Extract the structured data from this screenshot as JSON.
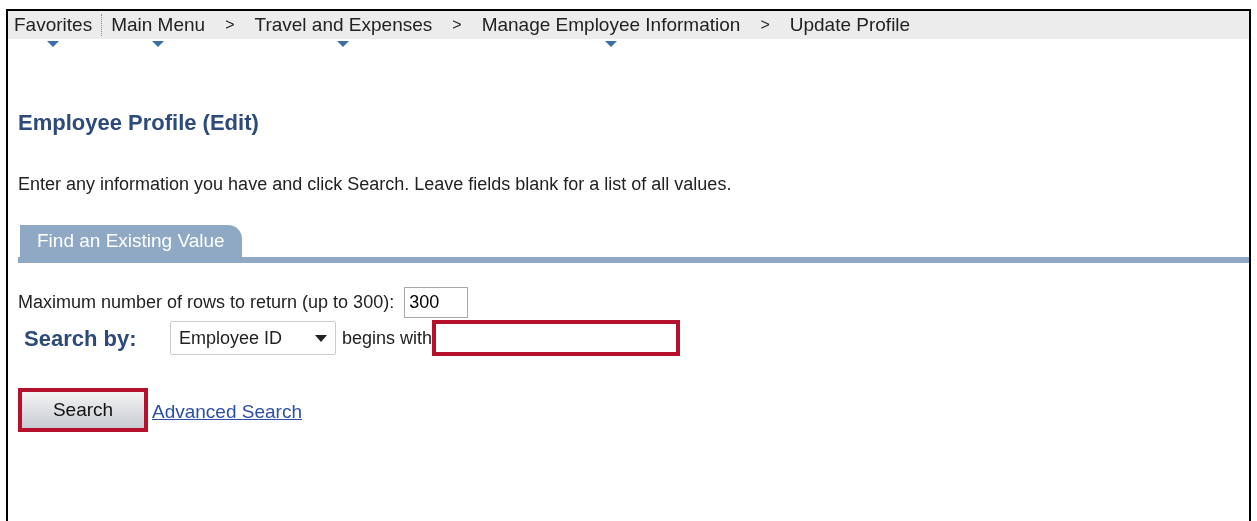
{
  "breadcrumb": [
    {
      "label": "Favorites",
      "dropdown": true
    },
    {
      "label": "Main Menu",
      "dropdown": true
    },
    {
      "separator": ">",
      "label": "Travel and Expenses",
      "dropdown": true
    },
    {
      "separator": ">",
      "label": "Manage Employee Information",
      "dropdown": true
    },
    {
      "separator": ">",
      "label": "Update Profile",
      "dropdown": false
    }
  ],
  "page_title": "Employee Profile (Edit)",
  "instructions": "Enter any information you have and click Search. Leave fields blank for a list of all values.",
  "tabs": [
    {
      "label": "Find an Existing Value",
      "selected": true
    }
  ],
  "max_rows": {
    "label": "Maximum number of rows to return (up to 300):",
    "value": "300"
  },
  "search_by": {
    "label": "Search by:",
    "field": "Employee ID",
    "operator": "begins with",
    "highlighted": true
  },
  "search_button": {
    "label": "Search",
    "highlighted": true
  },
  "advanced_link": "Advanced Search"
}
